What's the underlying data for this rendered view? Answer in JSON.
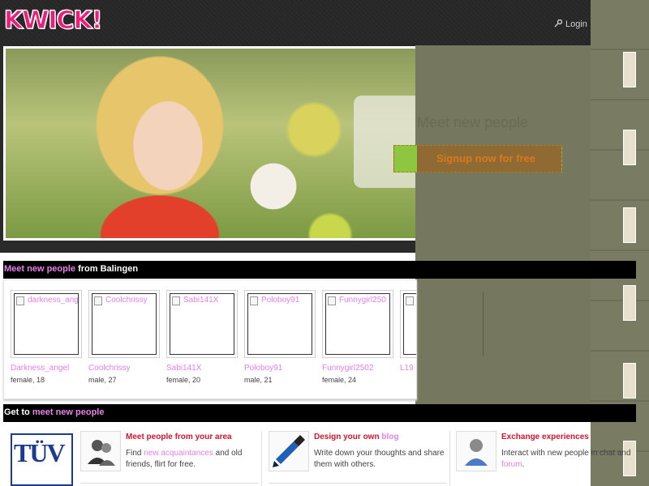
{
  "header": {
    "logo_text": "KWICK!",
    "login_label": "Login"
  },
  "hero": {
    "title": "Meet new people",
    "signup_button": "Signup now for free"
  },
  "meet_section": {
    "prefix": "Meet new people",
    "suffix": " from Balingen"
  },
  "people": [
    {
      "alt": "darkness_ang",
      "name": "Darkness_angel",
      "info": "female, 18"
    },
    {
      "alt": "Coolchrissy",
      "name": "Coolchrissy",
      "info": "male, 27"
    },
    {
      "alt": "Sabi141X",
      "name": "Sabi141X",
      "info": "female, 20"
    },
    {
      "alt": "Poloboy91",
      "name": "Poloboy91",
      "info": "male, 21"
    },
    {
      "alt": "Funnygirl250",
      "name": "Funnygirl2502",
      "info": "female, 24"
    },
    {
      "alt": "L",
      "name": "L19",
      "info": ""
    }
  ],
  "get_section": {
    "prefix": "Get to ",
    "highlight": "meet new people"
  },
  "features": [
    {
      "icon": "people-icon",
      "title": "Meet people from your area",
      "text_before": "Find ",
      "link": "new acquaintances",
      "text_after": " and old friends, flirt for free."
    },
    {
      "icon": "brush-icon",
      "title": "Design your own ",
      "title_link": "blog",
      "text_before": "Write down your thoughts and share them with others.",
      "link": "",
      "text_after": ""
    },
    {
      "icon": "user-icon",
      "title": "Exchange experiences",
      "text_before": "Interact with new people in chat and ",
      "link": "forum",
      "text_after": "."
    }
  ],
  "badge": {
    "text": "TÜV"
  },
  "colors": {
    "brand_pink": "#ec1e79",
    "link_pink": "#e880e8",
    "feature_red": "#d5142e",
    "overlay": "#76775f"
  }
}
